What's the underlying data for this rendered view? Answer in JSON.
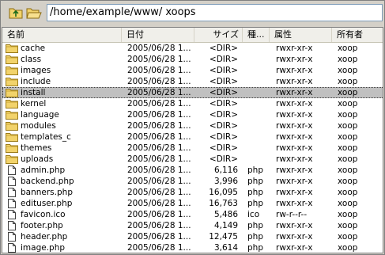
{
  "toolbar": {
    "up_icon": "folder-up-icon",
    "open_icon": "open-folder-icon",
    "path": "/home/example/www/ xoops"
  },
  "columns": [
    "名前",
    "日付",
    "サイズ",
    "種...",
    "属性",
    "所有者"
  ],
  "rows": [
    {
      "name": "cache",
      "kind": "folder",
      "date": "2005/06/28 1...",
      "size": "<DIR>",
      "type": "",
      "attr": "rwxr-xr-x",
      "owner": "xoop",
      "selected": false
    },
    {
      "name": "class",
      "kind": "folder",
      "date": "2005/06/28 1...",
      "size": "<DIR>",
      "type": "",
      "attr": "rwxr-xr-x",
      "owner": "xoop",
      "selected": false
    },
    {
      "name": "images",
      "kind": "folder",
      "date": "2005/06/28 1...",
      "size": "<DIR>",
      "type": "",
      "attr": "rwxr-xr-x",
      "owner": "xoop",
      "selected": false
    },
    {
      "name": "include",
      "kind": "folder",
      "date": "2005/06/28 1...",
      "size": "<DIR>",
      "type": "",
      "attr": "rwxr-xr-x",
      "owner": "xoop",
      "selected": false
    },
    {
      "name": "install",
      "kind": "folder",
      "date": "2005/06/28 1...",
      "size": "<DIR>",
      "type": "",
      "attr": "rwxr-xr-x",
      "owner": "xoop",
      "selected": true
    },
    {
      "name": "kernel",
      "kind": "folder",
      "date": "2005/06/28 1...",
      "size": "<DIR>",
      "type": "",
      "attr": "rwxr-xr-x",
      "owner": "xoop",
      "selected": false
    },
    {
      "name": "language",
      "kind": "folder",
      "date": "2005/06/28 1...",
      "size": "<DIR>",
      "type": "",
      "attr": "rwxr-xr-x",
      "owner": "xoop",
      "selected": false
    },
    {
      "name": "modules",
      "kind": "folder",
      "date": "2005/06/28 1...",
      "size": "<DIR>",
      "type": "",
      "attr": "rwxr-xr-x",
      "owner": "xoop",
      "selected": false
    },
    {
      "name": "templates_c",
      "kind": "folder",
      "date": "2005/06/28 1...",
      "size": "<DIR>",
      "type": "",
      "attr": "rwxr-xr-x",
      "owner": "xoop",
      "selected": false
    },
    {
      "name": "themes",
      "kind": "folder",
      "date": "2005/06/28 1...",
      "size": "<DIR>",
      "type": "",
      "attr": "rwxr-xr-x",
      "owner": "xoop",
      "selected": false
    },
    {
      "name": "uploads",
      "kind": "folder",
      "date": "2005/06/28 1...",
      "size": "<DIR>",
      "type": "",
      "attr": "rwxr-xr-x",
      "owner": "xoop",
      "selected": false
    },
    {
      "name": "admin.php",
      "kind": "file",
      "date": "2005/06/28 1...",
      "size": "6,116",
      "type": "php",
      "attr": "rwxr-xr-x",
      "owner": "xoop",
      "selected": false
    },
    {
      "name": "backend.php",
      "kind": "file",
      "date": "2005/06/28 1...",
      "size": "3,996",
      "type": "php",
      "attr": "rwxr-xr-x",
      "owner": "xoop",
      "selected": false
    },
    {
      "name": "banners.php",
      "kind": "file",
      "date": "2005/06/28 1...",
      "size": "16,095",
      "type": "php",
      "attr": "rwxr-xr-x",
      "owner": "xoop",
      "selected": false
    },
    {
      "name": "edituser.php",
      "kind": "file",
      "date": "2005/06/28 1...",
      "size": "16,763",
      "type": "php",
      "attr": "rwxr-xr-x",
      "owner": "xoop",
      "selected": false
    },
    {
      "name": "favicon.ico",
      "kind": "file",
      "date": "2005/06/28 1...",
      "size": "5,486",
      "type": "ico",
      "attr": "rw-r--r--",
      "owner": "xoop",
      "selected": false
    },
    {
      "name": "footer.php",
      "kind": "file",
      "date": "2005/06/28 1...",
      "size": "4,149",
      "type": "php",
      "attr": "rwxr-xr-x",
      "owner": "xoop",
      "selected": false
    },
    {
      "name": "header.php",
      "kind": "file",
      "date": "2005/06/28 1...",
      "size": "12,475",
      "type": "php",
      "attr": "rwxr-xr-x",
      "owner": "xoop",
      "selected": false
    },
    {
      "name": "image.php",
      "kind": "file",
      "date": "2005/06/28 1...",
      "size": "3,614",
      "type": "php",
      "attr": "rwxr-xr-x",
      "owner": "xoop",
      "selected": false
    }
  ],
  "colors": {
    "folder": "#f2d36b",
    "selected_row": "#c0c0c0"
  }
}
